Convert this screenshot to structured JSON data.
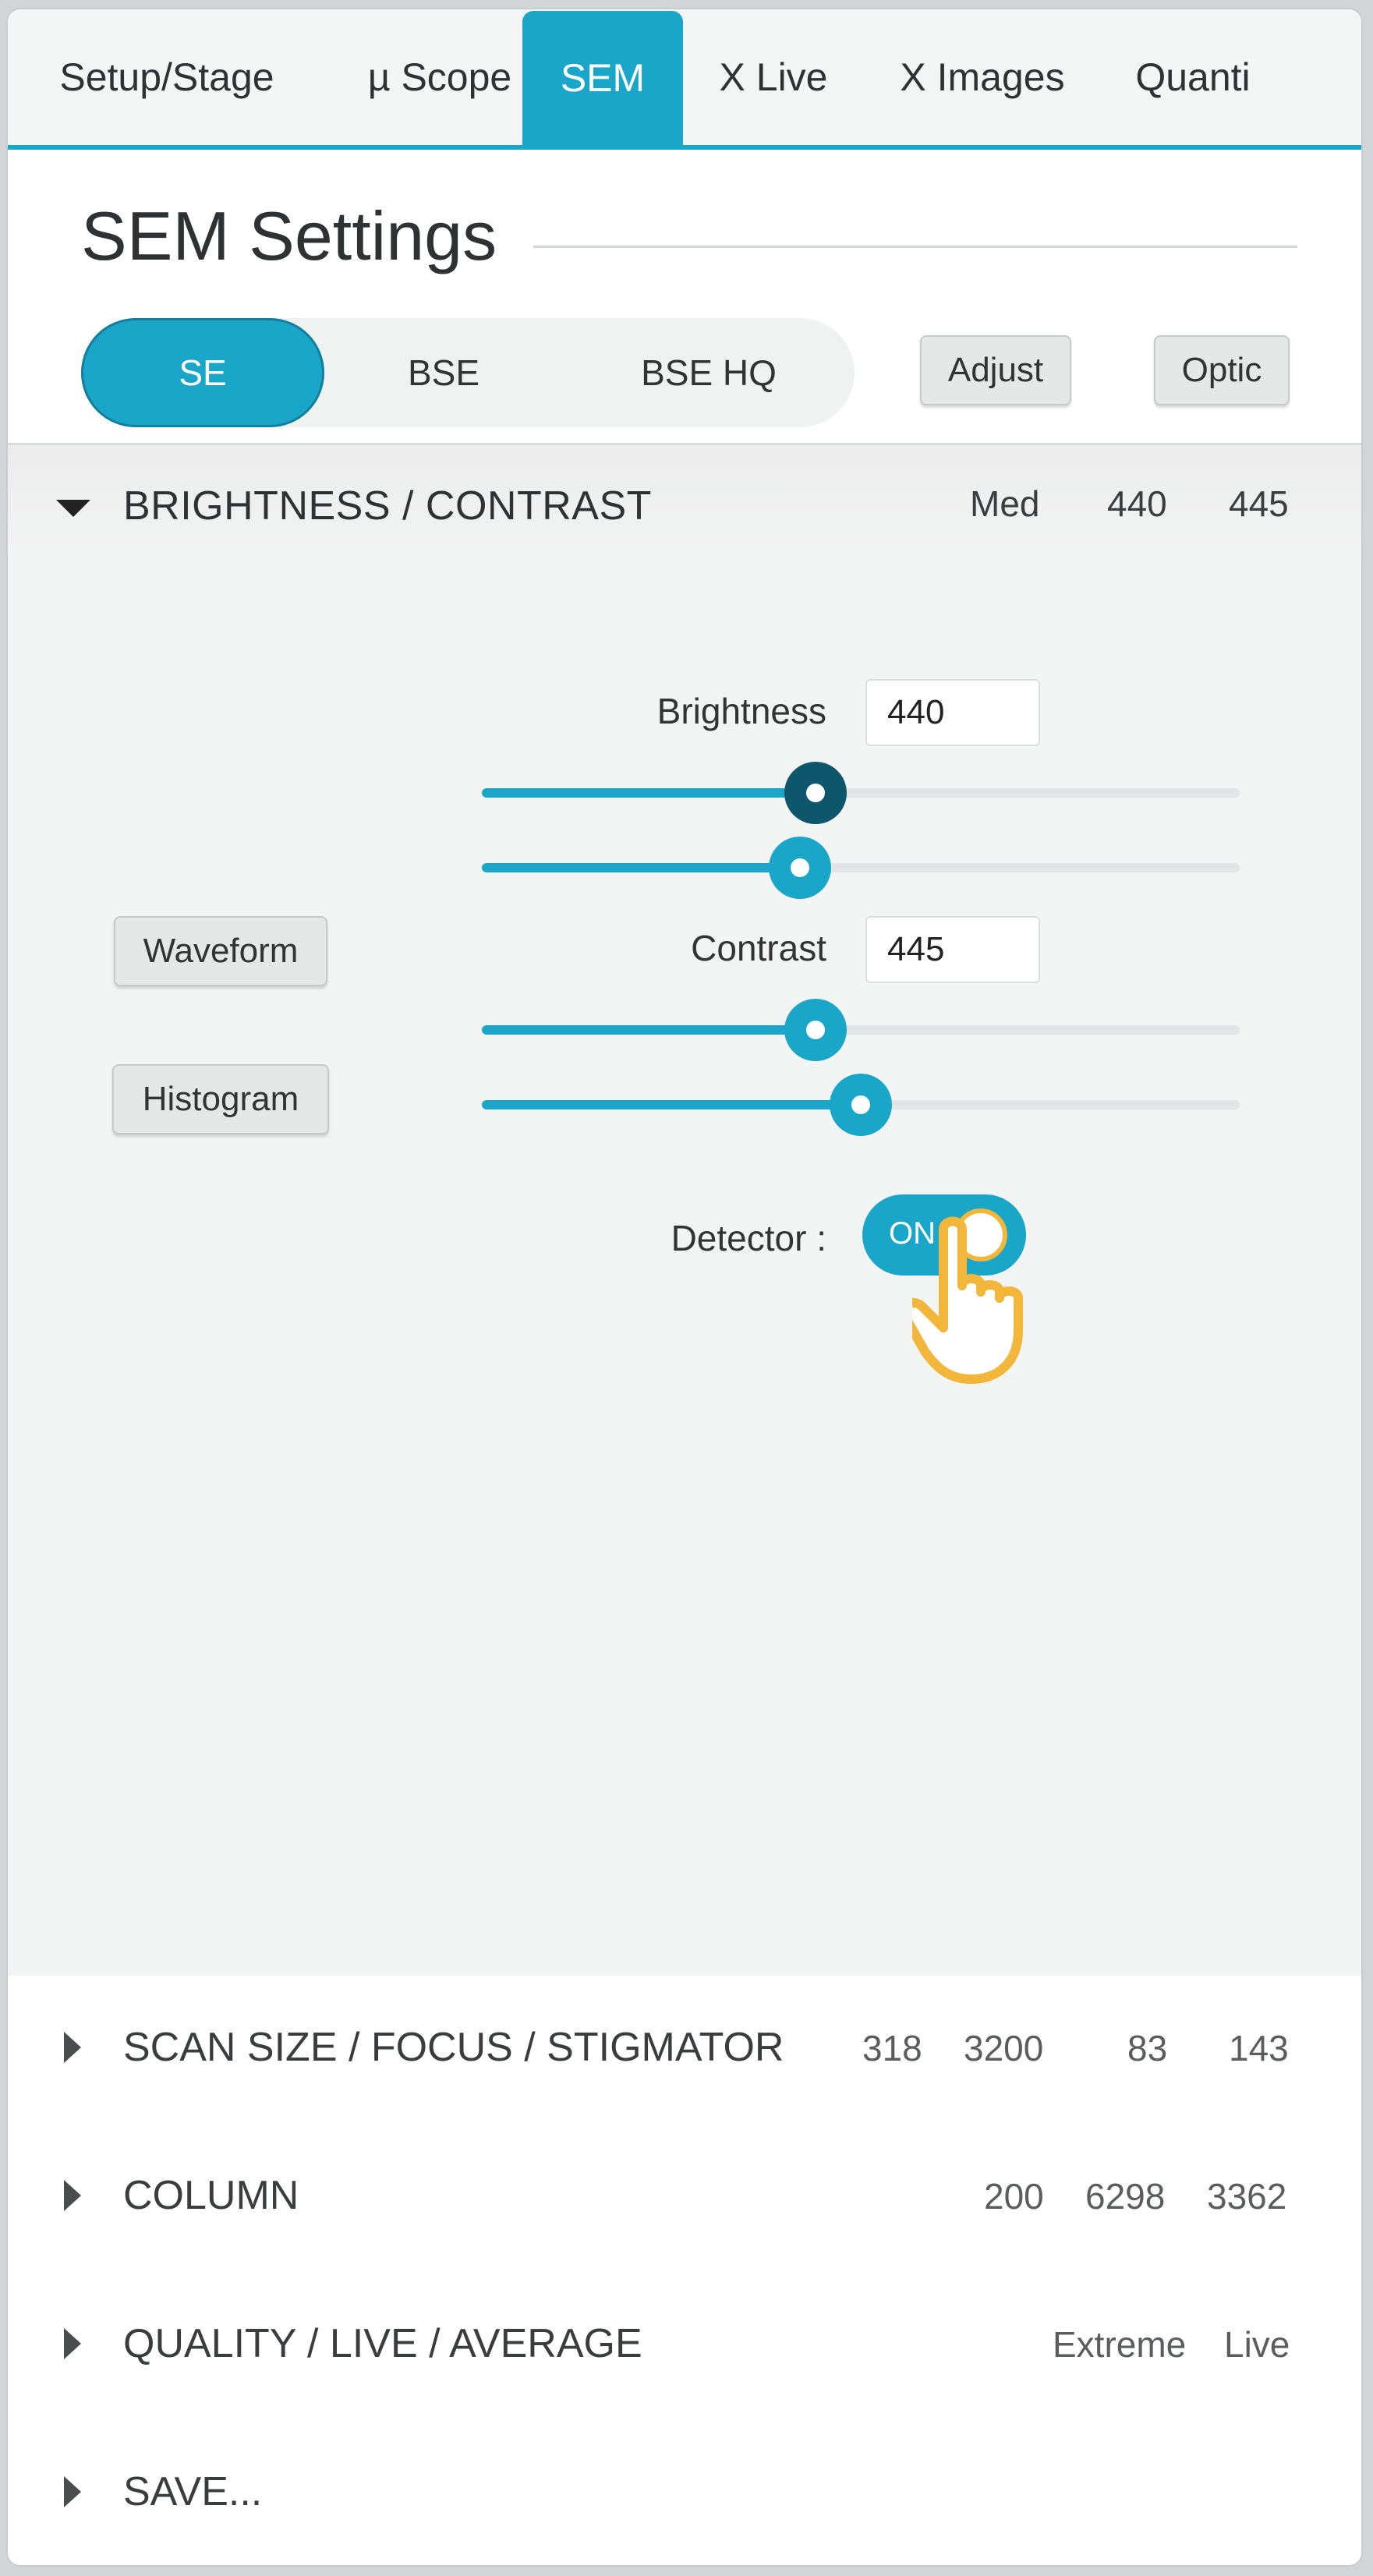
{
  "tabs": [
    {
      "label": "Setup/Stage",
      "active": false
    },
    {
      "label": "µ Scope",
      "active": false
    },
    {
      "label": "SEM",
      "active": true
    },
    {
      "label": "X Live",
      "active": false
    },
    {
      "label": "X Images",
      "active": false
    },
    {
      "label": "Quanti",
      "active": false
    }
  ],
  "header": {
    "title": "SEM Settings"
  },
  "detector_modes": [
    {
      "label": "SE",
      "selected": true
    },
    {
      "label": "BSE",
      "selected": false
    },
    {
      "label": "BSE HQ",
      "selected": false
    }
  ],
  "buttons": {
    "adjust": "Adjust",
    "optic": "Optic",
    "waveform": "Waveform",
    "histogram": "Histogram"
  },
  "brightness_contrast": {
    "title": "BRIGHTNESS / CONTRAST",
    "expanded": true,
    "summary": [
      "Med",
      "440",
      "445"
    ],
    "brightness_label": "Brightness",
    "brightness_value": "440",
    "contrast_label": "Contrast",
    "contrast_value": "445",
    "sliders": [
      {
        "name": "brightness-coarse",
        "fraction": 0.44
      },
      {
        "name": "brightness-fine",
        "fraction": 0.42
      },
      {
        "name": "contrast-coarse",
        "fraction": 0.44
      },
      {
        "name": "contrast-fine",
        "fraction": 0.5
      }
    ],
    "detector_label": "Detector :",
    "detector_state": "ON"
  },
  "sections": [
    {
      "title": "SCAN SIZE / FOCUS / STIGMATOR",
      "values": [
        "318",
        "3200",
        "83",
        "143"
      ]
    },
    {
      "title": "COLUMN",
      "values": [
        "200",
        "6298",
        "3362"
      ]
    },
    {
      "title": "QUALITY / LIVE / AVERAGE",
      "values": [
        "Extreme",
        "Live"
      ]
    },
    {
      "title": "SAVE...",
      "values": []
    }
  ],
  "colors": {
    "accent": "#1aa6c9",
    "accent_dark": "#0e566c",
    "pointer": "#f2b63a",
    "panel_bg": "#f3f4f4"
  },
  "icons": {
    "expanded": "triangle-down-icon",
    "collapsed": "triangle-right-icon",
    "pointer": "hand-pointer-icon"
  }
}
